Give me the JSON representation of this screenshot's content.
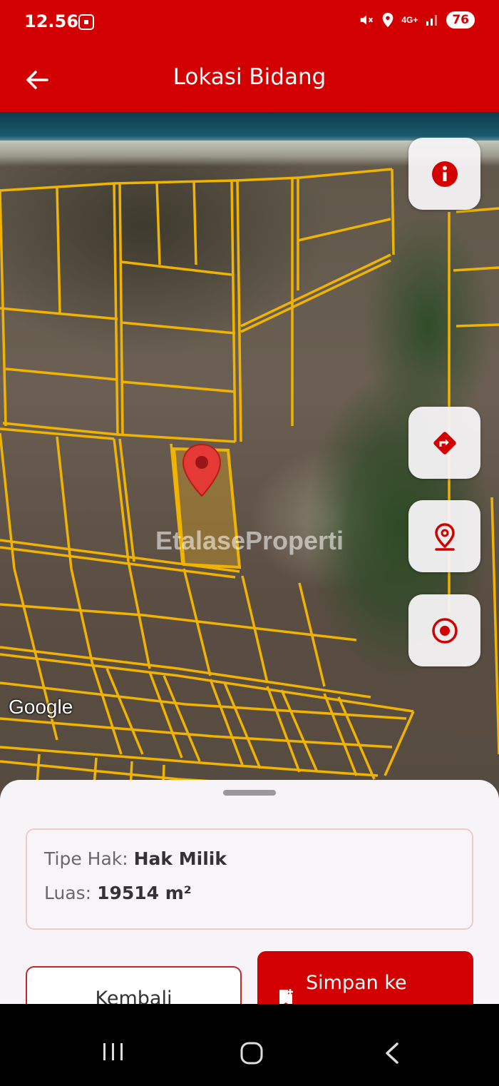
{
  "status_bar": {
    "time": "12.56",
    "network": "4G+",
    "battery": "76"
  },
  "app_bar": {
    "title": "Lokasi Bidang",
    "back_icon": "arrow-left-icon"
  },
  "map": {
    "watermark": "EtalaseProperti",
    "attribution": "Google",
    "controls": [
      {
        "name": "info",
        "icon": "info-icon"
      },
      {
        "name": "directions",
        "icon": "directions-icon"
      },
      {
        "name": "location-pin",
        "icon": "location-pin-icon"
      },
      {
        "name": "my-location",
        "icon": "target-icon"
      }
    ],
    "marker_icon": "map-marker-icon"
  },
  "sheet": {
    "tipe_hak_label": "Tipe Hak:",
    "tipe_hak_value": "Hak Milik",
    "luas_label": "Luas:",
    "luas_value": "19514 m²",
    "back_button": "Kembali",
    "save_button": "Simpan ke Koleksi",
    "save_icon": "bookmark-add-icon"
  },
  "nav_bar": {
    "items": [
      "recent-apps-icon",
      "home-icon",
      "back-icon"
    ]
  },
  "colors": {
    "primary": "#d20000",
    "parcel_line": "#f0b400"
  }
}
